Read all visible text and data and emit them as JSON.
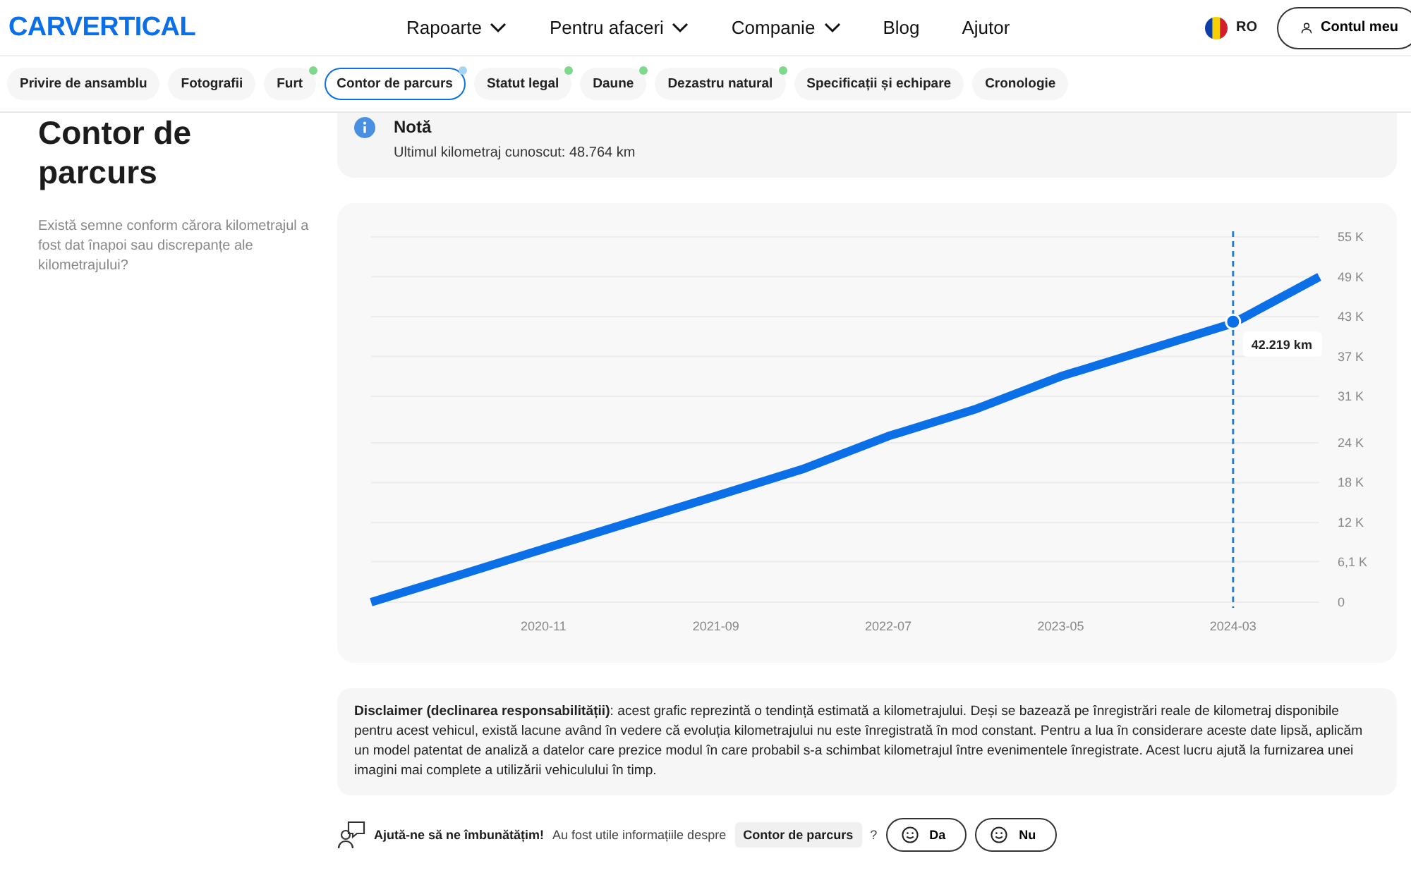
{
  "header": {
    "logo": "CARVERTICAL",
    "nav": [
      {
        "label": "Rapoarte",
        "dropdown": true
      },
      {
        "label": "Pentru afaceri",
        "dropdown": true
      },
      {
        "label": "Companie",
        "dropdown": true
      },
      {
        "label": "Blog",
        "dropdown": false
      },
      {
        "label": "Ajutor",
        "dropdown": false
      }
    ],
    "language": "RO",
    "account_button": "Contul meu"
  },
  "tabs": [
    {
      "label": "Privire de ansamblu",
      "selected": false
    },
    {
      "label": "Fotografii",
      "selected": false
    },
    {
      "label": "Furt",
      "selected": false,
      "color": "#7ed98f"
    },
    {
      "label": "Contor de parcurs",
      "selected": true,
      "color": "#a8d4f0"
    },
    {
      "label": "Statut legal",
      "selected": false,
      "color": "#7ed98f"
    },
    {
      "label": "Daune",
      "selected": false,
      "color": "#7ed98f"
    },
    {
      "label": "Dezastru natural",
      "selected": false,
      "color": "#7ed98f"
    },
    {
      "label": "Specificații și echipare",
      "selected": false
    },
    {
      "label": "Cronologie",
      "selected": false
    }
  ],
  "section": {
    "title": "Contor de parcurs",
    "description": "Există semne conform cărora kilometrajul a fost dat înapoi sau discrepanțe ale kilometrajului?"
  },
  "note": {
    "title": "Notă",
    "text": "Ultimul kilometraj cunoscut: 48.764 km"
  },
  "chart": {
    "chart_data": {
      "type": "line",
      "categories": [
        null,
        null,
        "2020-11",
        null,
        "2021-09",
        null,
        "2022-07",
        null,
        "2023-05",
        null,
        "2024-03",
        null
      ],
      "series": [
        {
          "color": "#0b6fe8",
          "values": [
            0,
            4000,
            8000,
            12000,
            16000,
            20000,
            25000,
            29000,
            34000,
            38000,
            42000,
            49000
          ]
        }
      ],
      "ylim": [
        0,
        55000
      ],
      "grid": true,
      "ref_lines": [
        {
          "axis": "x",
          "value": "2024-03",
          "color": "#2f7fc8"
        }
      ],
      "yticks": [
        {
          "value": 0,
          "label": "0"
        },
        {
          "value": 6100,
          "label": "6,1 K"
        },
        {
          "value": 12000,
          "label": "12 K"
        },
        {
          "value": 18000,
          "label": "18 K"
        },
        {
          "value": 24000,
          "label": "24 K"
        },
        {
          "value": 31000,
          "label": "31 K"
        },
        {
          "value": 37000,
          "label": "37 K"
        },
        {
          "value": 43000,
          "label": "43 K"
        },
        {
          "value": 49000,
          "label": "49 K"
        },
        {
          "value": 55000,
          "label": "55 K"
        }
      ],
      "annotations": [
        {
          "x": "2024-03",
          "y": 42219,
          "text": "42.219 km"
        }
      ]
    }
  },
  "disclaimer": "**Disclaimer (declinarea responsabilității)**: acest grafic reprezintă o tendință estimată a kilometrajului. Deși se bazează pe înregistrări reale de kilometraj disponibile pentru acest vehicul, există lacune având în vedere că evoluția kilometrajului nu este înregistrată în mod constant. Pentru a lua în considerare aceste date lipsă, aplicăm un model patentat de analiză a datelor care prezice modul în care probabil s-a schimbat kilometrajul între evenimentele înregistrate. Acest lucru ajută la furnizarea unei imagini mai complete a utilizării vehiculului în timp.",
  "feedback": {
    "title": "Ajută-ne să ne îmbunătățim!",
    "question": "Au fost utile informațiile despre",
    "topic": "Contor de parcurs",
    "question_mark": "?",
    "answers": [
      "Da",
      "Nu"
    ]
  }
}
